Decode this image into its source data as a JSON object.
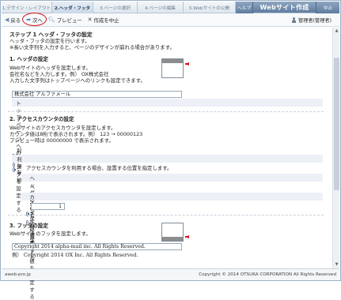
{
  "steps": [
    {
      "label": "1.デザイン・レイアウト",
      "active": false
    },
    {
      "label": "2.ヘッダ・フッタ",
      "active": true
    },
    {
      "label": "3.ページの選択",
      "active": false
    },
    {
      "label": "4.ページの編集",
      "active": false
    },
    {
      "label": "5.Webサイトの公開",
      "active": false
    }
  ],
  "header": {
    "help_label": "ヘルプ",
    "app_title": "Webサイト作成",
    "abort_label": "中止"
  },
  "toolbar": {
    "back_label": "戻る",
    "next_label": "次へ",
    "preview_label": "プレビュー",
    "abort_label": "作成を中止",
    "user_label": "管理者(管理者)"
  },
  "intro": {
    "title": "ステップ 1 ヘッダ・フッタの設定",
    "line1": "ヘッダ・フッタの設定を行います。",
    "line2": "※長い文字列を入力すると、ページのデザインが崩れる場合があります。"
  },
  "header_section": {
    "title": "1. ヘッダの設定",
    "desc1": "Webサイトのヘッダを設定します。",
    "desc2": "会社名などを入力します。例） OX株式会社",
    "desc3": "入力した文字列はトップページへのリンクも設定できます。",
    "input_value": "株式会社 アルファメール",
    "link_checkbox_label": "トップページへのリンクを設定する",
    "link_checked": true
  },
  "counter_section": {
    "title": "2. アクセスカウンタの設定",
    "desc1": "Webサイトのアクセスカウンタを設定します。",
    "desc2": "カウンタ値は8桁で表示されます。例） 123 → 00000123",
    "desc3": "プレビュー時は 00000000 で表示されます。",
    "option_off": "利用しない",
    "option_on": "利用する",
    "selected": "利用する",
    "position_instruction": "アクセスカウンタを利用する場合、設置する位置を指定します。",
    "pos_left": "ヘッダの左下に設置する",
    "pos_right": "ヘッダの右下に設置する",
    "pos_selected": "ヘッダの左下に設置する",
    "start_checkbox_label": "カウンタのスタート値を設定する",
    "start_checked": true,
    "start_value": "1"
  },
  "footer_section": {
    "title": "3. フッタの設定",
    "desc1": "Webサイトのフッタを設定します。",
    "input_value": "Copyright 2014 alpha-mail inc. All Rights Reserved.",
    "example": "例） Copyright 2014 OX Inc. All Rights Reserved."
  },
  "footer": {
    "left_text": "aweb-pro.jp",
    "right_text": "Copyright © 2014 OTSUKA CORPORATION All Rights Reserved"
  },
  "colors": {
    "accent_red": "#d8121a",
    "title_bar_blue": "#5f7c9f",
    "shaded_row": "#eef0f8"
  },
  "icons": {
    "back": "back-arrow-icon",
    "next": "next-arrow-icon",
    "preview": "magnifier-icon",
    "abort": "close-x-icon",
    "user": "user-icon"
  }
}
